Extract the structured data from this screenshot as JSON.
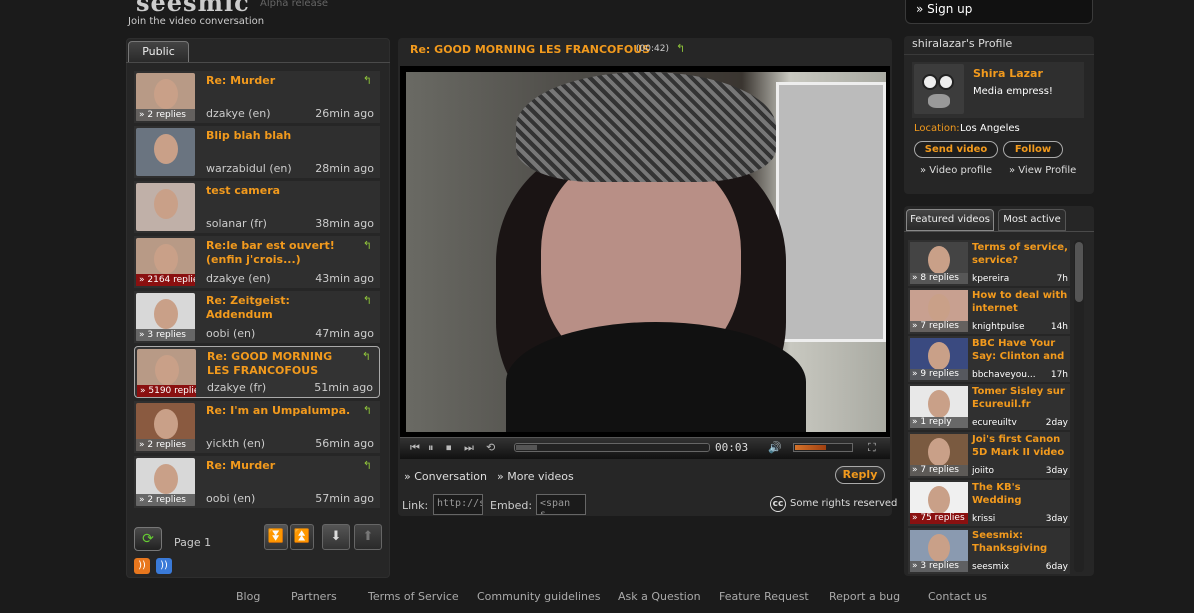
{
  "header": {
    "logo": "seesmic",
    "alpha": "Alpha release",
    "tagline": "Join the video conversation",
    "signup": "» Sign up"
  },
  "left": {
    "tab": "Public",
    "items": [
      {
        "title": "Re: Murder",
        "user": "dzakye (en)",
        "time": "26min ago",
        "replies": "» 2 replies",
        "reply_arrow": "↰",
        "red": false,
        "bg": "#b89a86"
      },
      {
        "title": "Blip blah blah",
        "user": "warzabidul (en)",
        "time": "28min ago",
        "replies": "",
        "reply_arrow": "",
        "red": false,
        "bg": "#6a7480"
      },
      {
        "title": "test camera",
        "user": "solanar (fr)",
        "time": "38min ago",
        "replies": "",
        "reply_arrow": "",
        "red": false,
        "bg": "#c0b0a8"
      },
      {
        "title": "Re:le bar est ouvert! (enfin j'crois...)",
        "user": "dzakye (en)",
        "time": "43min ago",
        "replies": "» 2164 replies",
        "reply_arrow": "↰",
        "red": true,
        "bg": "#b89a86"
      },
      {
        "title": "Re: Zeitgeist: Addendum",
        "user": "oobi (en)",
        "time": "47min ago",
        "replies": "» 3 replies",
        "reply_arrow": "↰",
        "red": false,
        "bg": "#d8d8d8"
      },
      {
        "title": "Re: GOOD MORNING LES FRANCOFOUS",
        "user": "dzakye (fr)",
        "time": "51min ago",
        "replies": "» 5190 replies",
        "reply_arrow": "↰",
        "red": true,
        "bg": "#b89a86"
      },
      {
        "title": "Re: I'm an Umpalumpa.",
        "user": "yickth (en)",
        "time": "56min ago",
        "replies": "» 2 replies",
        "reply_arrow": "↰",
        "red": false,
        "bg": "#8a5a40"
      },
      {
        "title": "Re: Murder",
        "user": "oobi (en)",
        "time": "57min ago",
        "replies": "» 2 replies",
        "reply_arrow": "↰",
        "red": false,
        "bg": "#d8d8d8"
      }
    ],
    "refresh_icon": "⟳",
    "page": "Page 1",
    "nav": {
      "down_double": "⏬",
      "up_double": "⏫",
      "down": "⬇",
      "up": "⬆"
    }
  },
  "video": {
    "title": "Re: GOOD MORNING LES FRANCOFOUS",
    "duration": "(00:42)",
    "reply_icon": "↰",
    "elapsed": "00:03",
    "progress": 0.11,
    "volume": 0.55,
    "controls": {
      "prev": "⏮",
      "pause": "⏸",
      "stop": "⏹",
      "next": "⏭",
      "loop": "⟲",
      "volume": "🔊",
      "fullscreen": "⛶"
    },
    "conversation_link": "» Conversation",
    "more_link": "» More videos",
    "reply_button": "Reply",
    "link_label": "Link:",
    "link_value": "http://s",
    "embed_label": "Embed:",
    "embed_value": "<span s",
    "rights": "Some rights reserved",
    "cc_icon": "cc"
  },
  "profile": {
    "header": "shiralazar's Profile",
    "name": "Shira Lazar",
    "bio": "Media empress!",
    "location_label": "Location:",
    "location": "Los Angeles",
    "send_video": "Send video",
    "follow": "Follow",
    "video_profile": "» Video profile",
    "view_profile": "» View Profile"
  },
  "featured": {
    "tabs": [
      "Featured videos",
      "Most active"
    ],
    "items": [
      {
        "title": "Terms of service, service?",
        "user": "kpereira",
        "time": "7h",
        "replies": "» 8 replies",
        "red": false,
        "bg": "#444"
      },
      {
        "title": "How to deal with internet",
        "user": "knightpulse",
        "time": "14h",
        "replies": "» 7 replies",
        "red": false,
        "bg": "#c8a090"
      },
      {
        "title": "BBC Have Your Say: Clinton and",
        "user": "bbchaveyou...",
        "time": "17h",
        "replies": "» 9 replies",
        "red": false,
        "bg": "#3a4a80"
      },
      {
        "title": "Tomer Sisley sur Ecureuil.fr",
        "user": "ecureuiltv",
        "time": "2day",
        "replies": "» 1 reply",
        "red": false,
        "bg": "#e8e8e8"
      },
      {
        "title": "Joi's first Canon 5D Mark II video",
        "user": "joiito",
        "time": "3day",
        "replies": "» 7 replies",
        "red": false,
        "bg": "#7a5a40"
      },
      {
        "title": "The KB's Wedding",
        "user": "krissi",
        "time": "3day",
        "replies": "» 75 replies",
        "red": true,
        "bg": "#f0f0f0"
      },
      {
        "title": "Seesmix: Thanksgiving",
        "user": "seesmix",
        "time": "6day",
        "replies": "» 3 replies",
        "red": false,
        "bg": "#8a9ab0"
      }
    ]
  },
  "footer": [
    "Blog",
    "Partners",
    "Terms of Service",
    "Community guidelines",
    "Ask a Question",
    "Feature Request",
    "Report a bug",
    "Contact us"
  ],
  "colors": {
    "accent": "#f29a1d",
    "reply_green": "#8fc43a",
    "badge_red": "#8a1010"
  }
}
